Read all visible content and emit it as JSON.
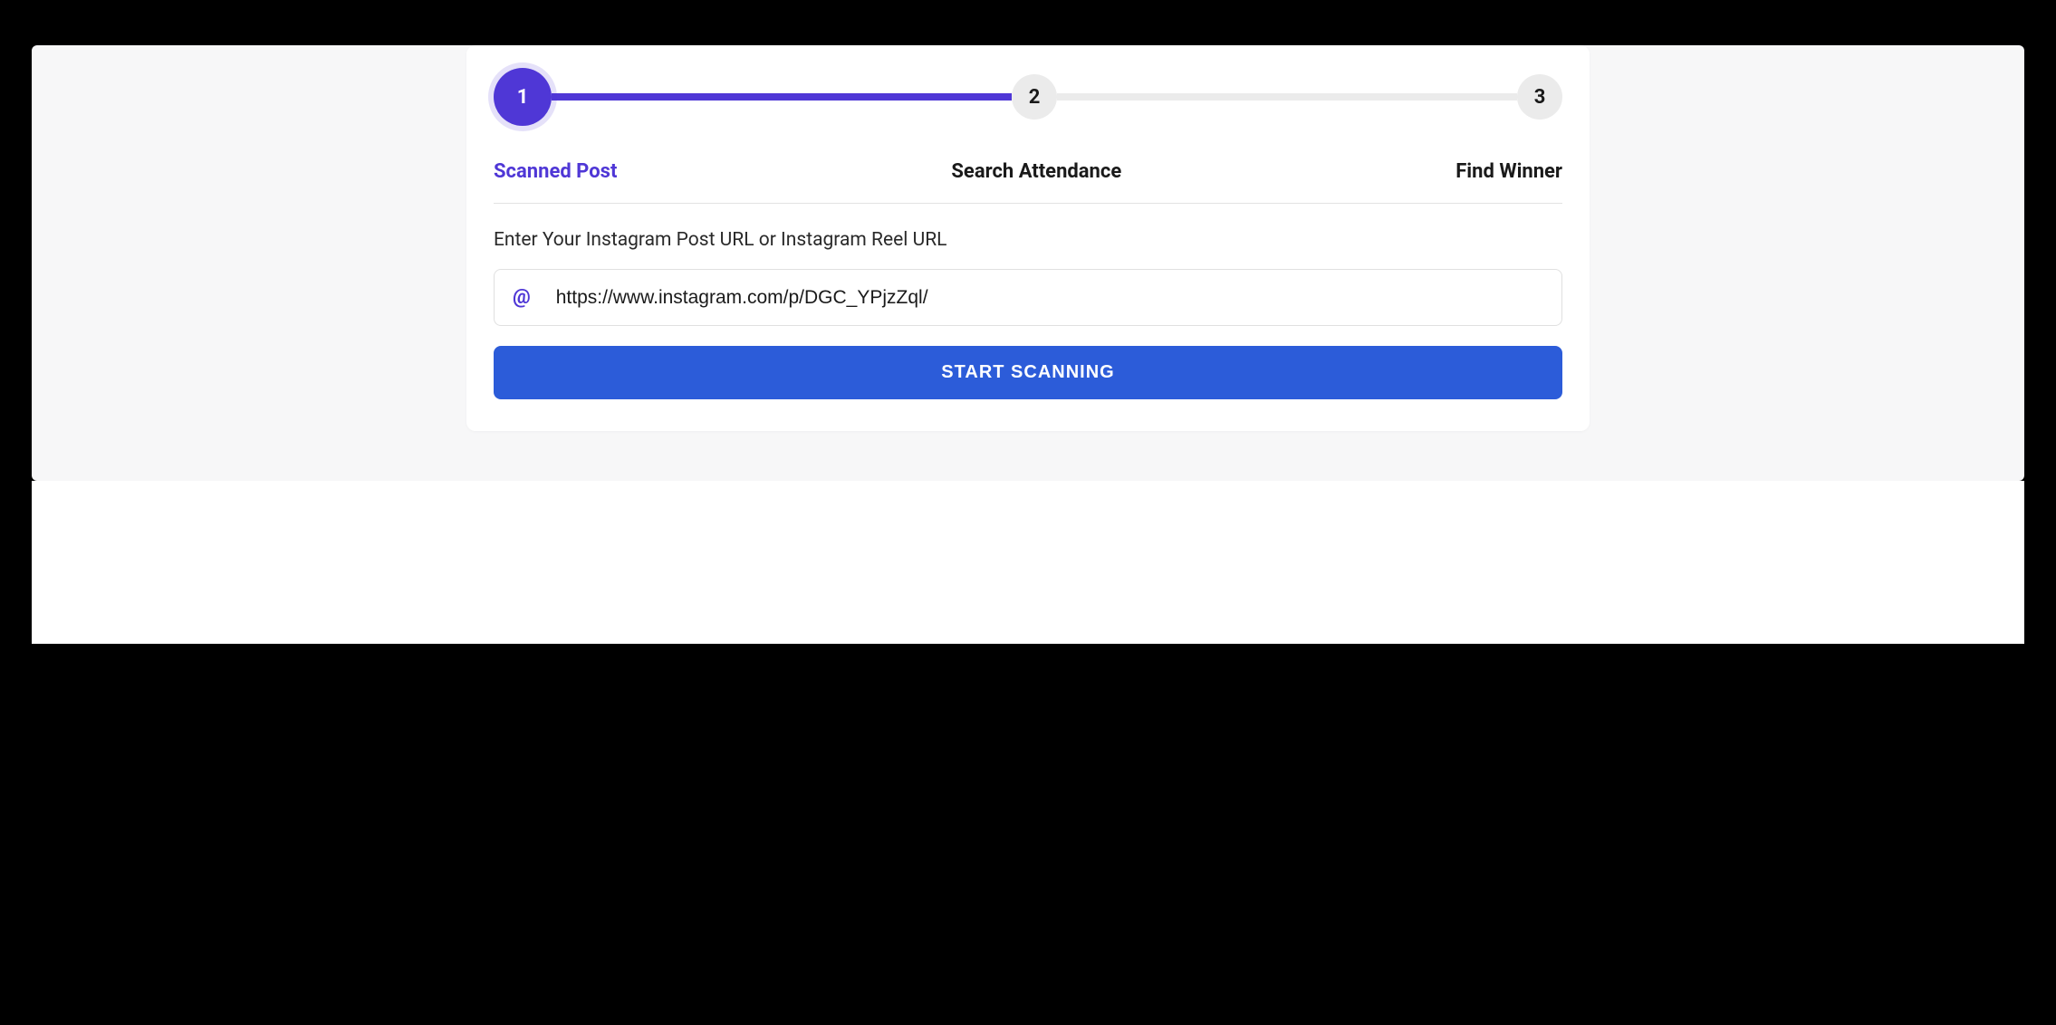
{
  "stepper": {
    "steps": [
      {
        "number": "1",
        "label": "Scanned Post",
        "active": true
      },
      {
        "number": "2",
        "label": "Search Attendance",
        "active": false
      },
      {
        "number": "3",
        "label": "Find Winner",
        "active": false
      }
    ]
  },
  "form": {
    "label": "Enter Your Instagram Post URL or Instagram Reel URL",
    "icon": "@",
    "input_value": "https://www.instagram.com/p/DGC_YPjzZql/",
    "button_label": "START SCANNING"
  }
}
